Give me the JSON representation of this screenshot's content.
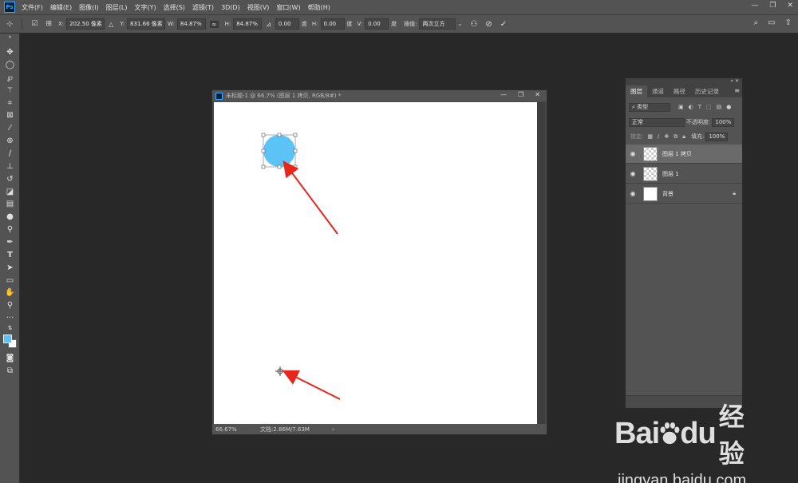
{
  "app": {
    "logo_text": "Ps",
    "menu": [
      "文件(F)",
      "编辑(E)",
      "图像(I)",
      "图层(L)",
      "文字(Y)",
      "选择(S)",
      "滤镜(T)",
      "3D(D)",
      "视图(V)",
      "窗口(W)",
      "帮助(H)"
    ],
    "window_controls": [
      "—",
      "❐",
      "✕"
    ]
  },
  "options": {
    "x_label": "X:",
    "x_value": "202.50 像素",
    "y_label": "Y:",
    "y_value": "831.66 像素",
    "w_label": "W:",
    "w_value": "84.87%",
    "h_label": "H:",
    "h_value": "84.87%",
    "angle_value": "0.00",
    "angle_unit": "度",
    "hskew_label": "H:",
    "hskew_value": "0.00",
    "hskew_unit": "度",
    "vskew_label": "V:",
    "vskew_value": "0.00",
    "vskew_unit": "度",
    "interp_label": "插值:",
    "interp_value": "两次立方"
  },
  "document": {
    "title": "未标题-1 @ 66.7% (图层 1 拷贝, RGB/8#) *",
    "zoom": "66.67%",
    "doc_size": "文档:2.86M/7.63M",
    "controls": [
      "—",
      "❐",
      "✕"
    ],
    "circle_color": "#5bc3f5",
    "arrow_color": "#e8261c"
  },
  "layers_panel": {
    "tabs": [
      "图层",
      "通道",
      "路径",
      "历史记录"
    ],
    "filter_placeholder": "类型",
    "blend_mode": "正常",
    "opacity_label": "不透明度:",
    "opacity_value": "100%",
    "lock_label": "锁定:",
    "fill_label": "填充:",
    "fill_value": "100%",
    "layers": [
      {
        "name": "图层 1 拷贝",
        "selected": true
      },
      {
        "name": "图层 1",
        "selected": false
      },
      {
        "name": "背景",
        "selected": false,
        "locked": true
      }
    ]
  },
  "watermark": {
    "brand_latin": "Bai",
    "brand_latin2": "du",
    "brand_cn": "经验",
    "url": "jingyan.baidu.com"
  }
}
